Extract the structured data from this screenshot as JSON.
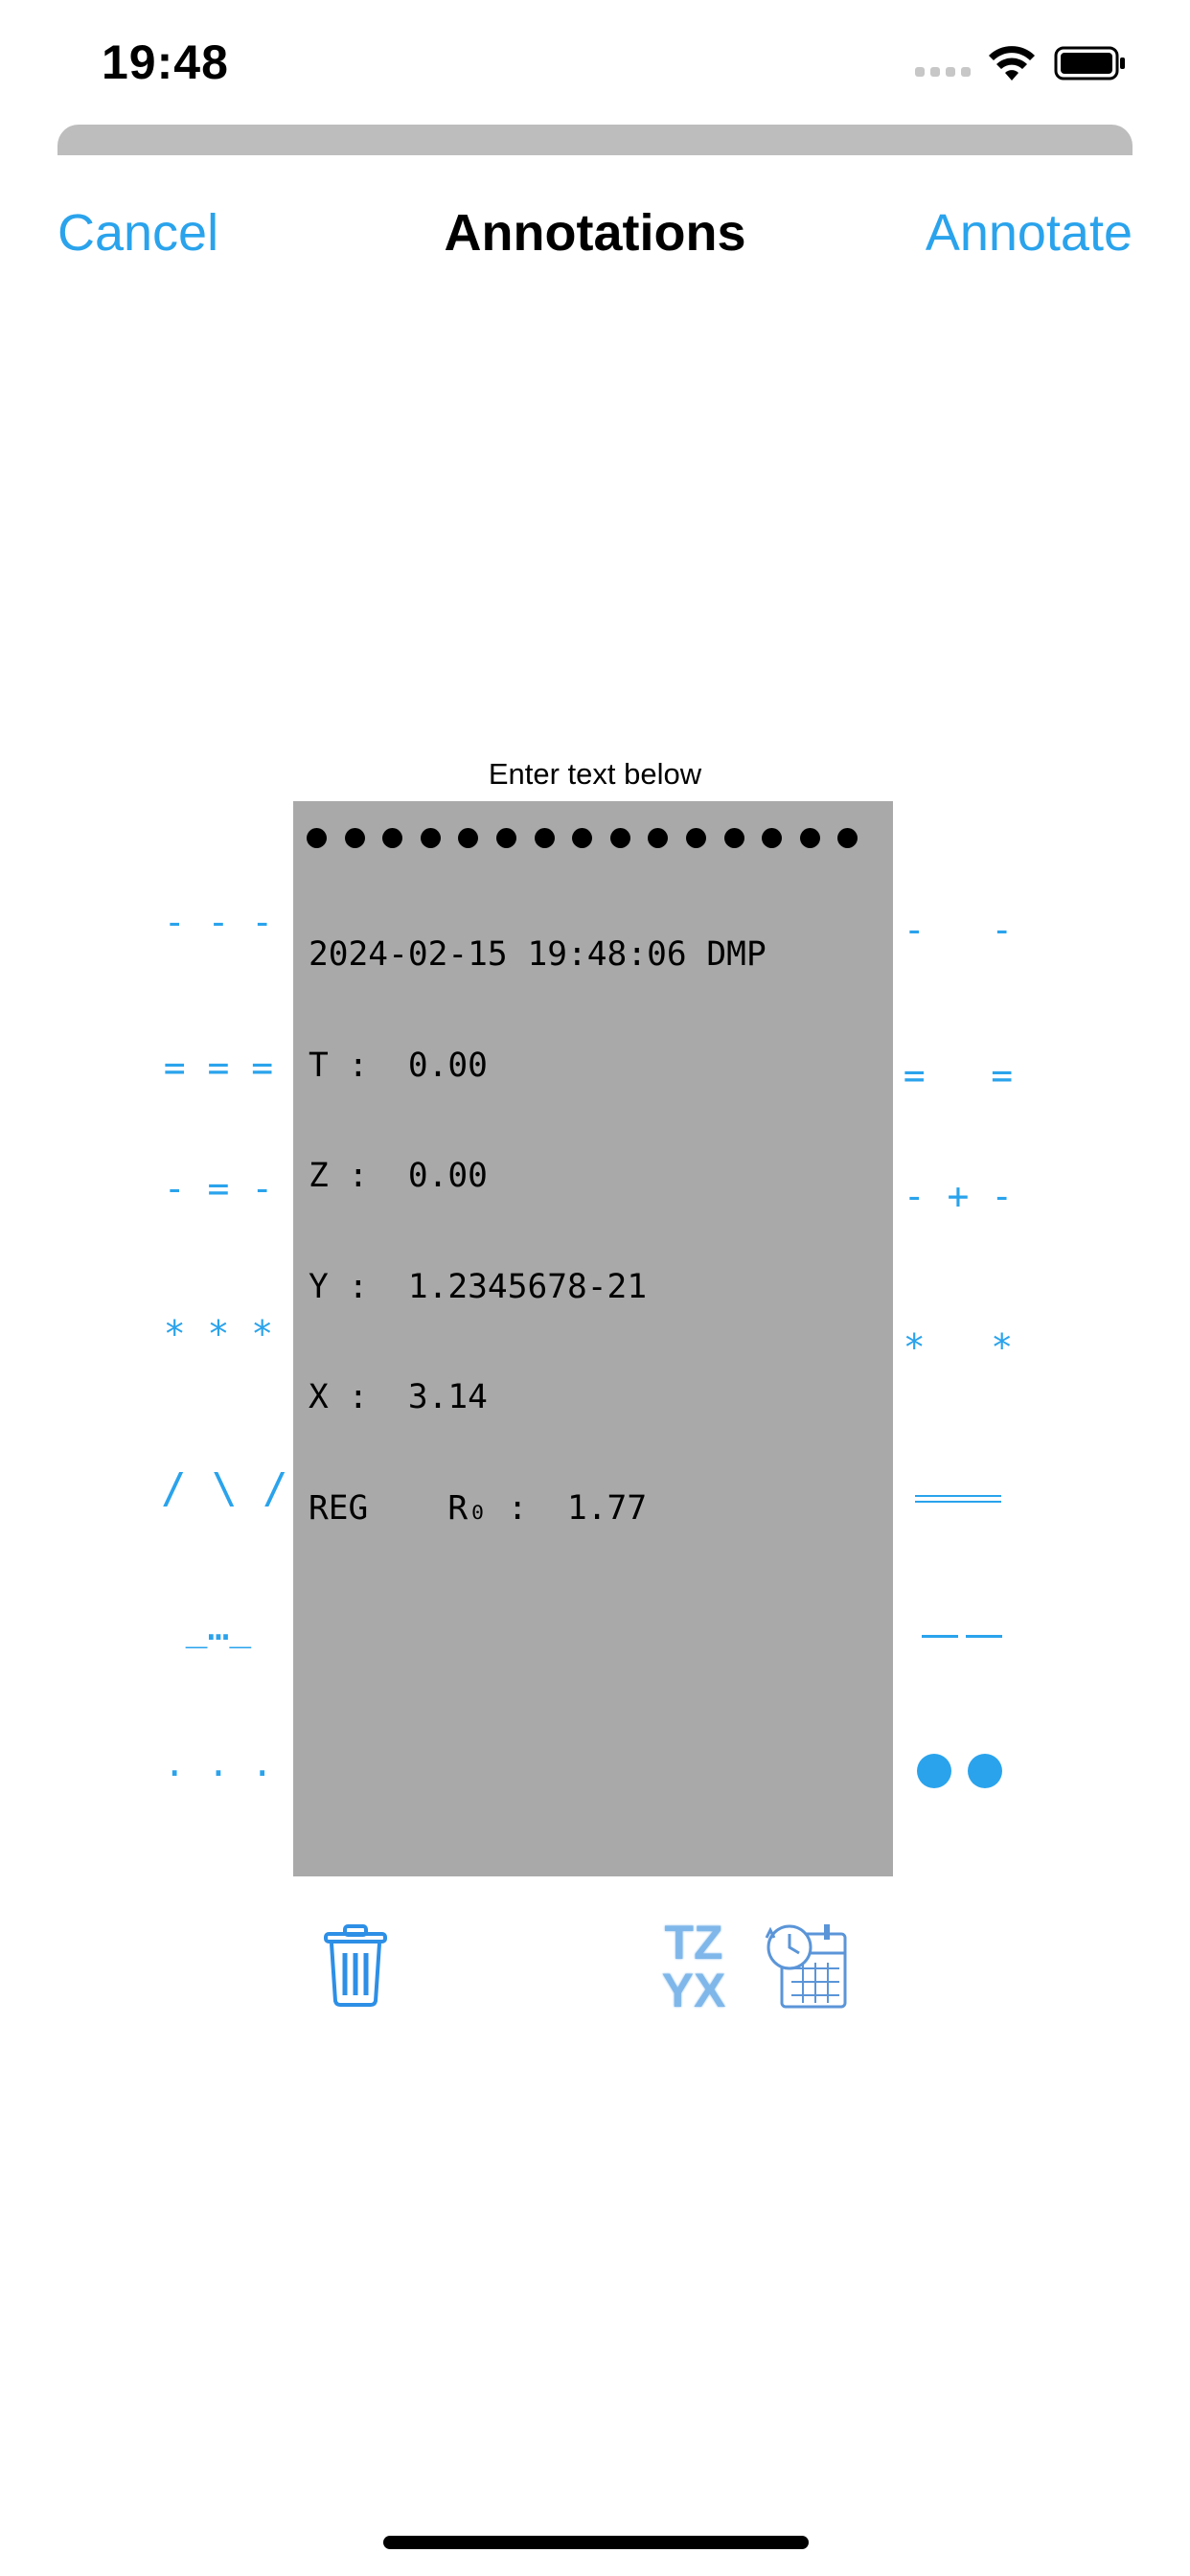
{
  "status_bar": {
    "time": "19:48"
  },
  "nav": {
    "cancel": "Cancel",
    "title": "Annotations",
    "annotate": "Annotate"
  },
  "editor": {
    "prompt": "Enter text below",
    "dots_count": 15,
    "lines": [
      "2024-02-15 19:48:06 DMP",
      "T :  0.00",
      "Z :  0.00",
      "Y :  1.2345678-21",
      "X :  3.14",
      "REG    R₀ :  1.77"
    ]
  },
  "left_annotations": [
    "- - -",
    "= = =",
    "- = -",
    "* * *",
    "/ \\ /",
    "_…_",
    ". . ."
  ],
  "right_annotations": [
    "-   -",
    "=   =",
    "- + -",
    "*   *",
    "double-line",
    "dashes",
    "big-dots"
  ],
  "toolbar": {
    "tzyx_top": "TZ",
    "tzyx_bottom": "YX"
  },
  "icons": {
    "trash": "trash-icon",
    "calendar": "calendar-clock-icon",
    "wifi": "wifi-icon",
    "battery": "battery-icon"
  },
  "colors": {
    "accent": "#2aa3ec",
    "paper": "#a9a9a9",
    "sheet_handle": "#bdbdbd"
  }
}
